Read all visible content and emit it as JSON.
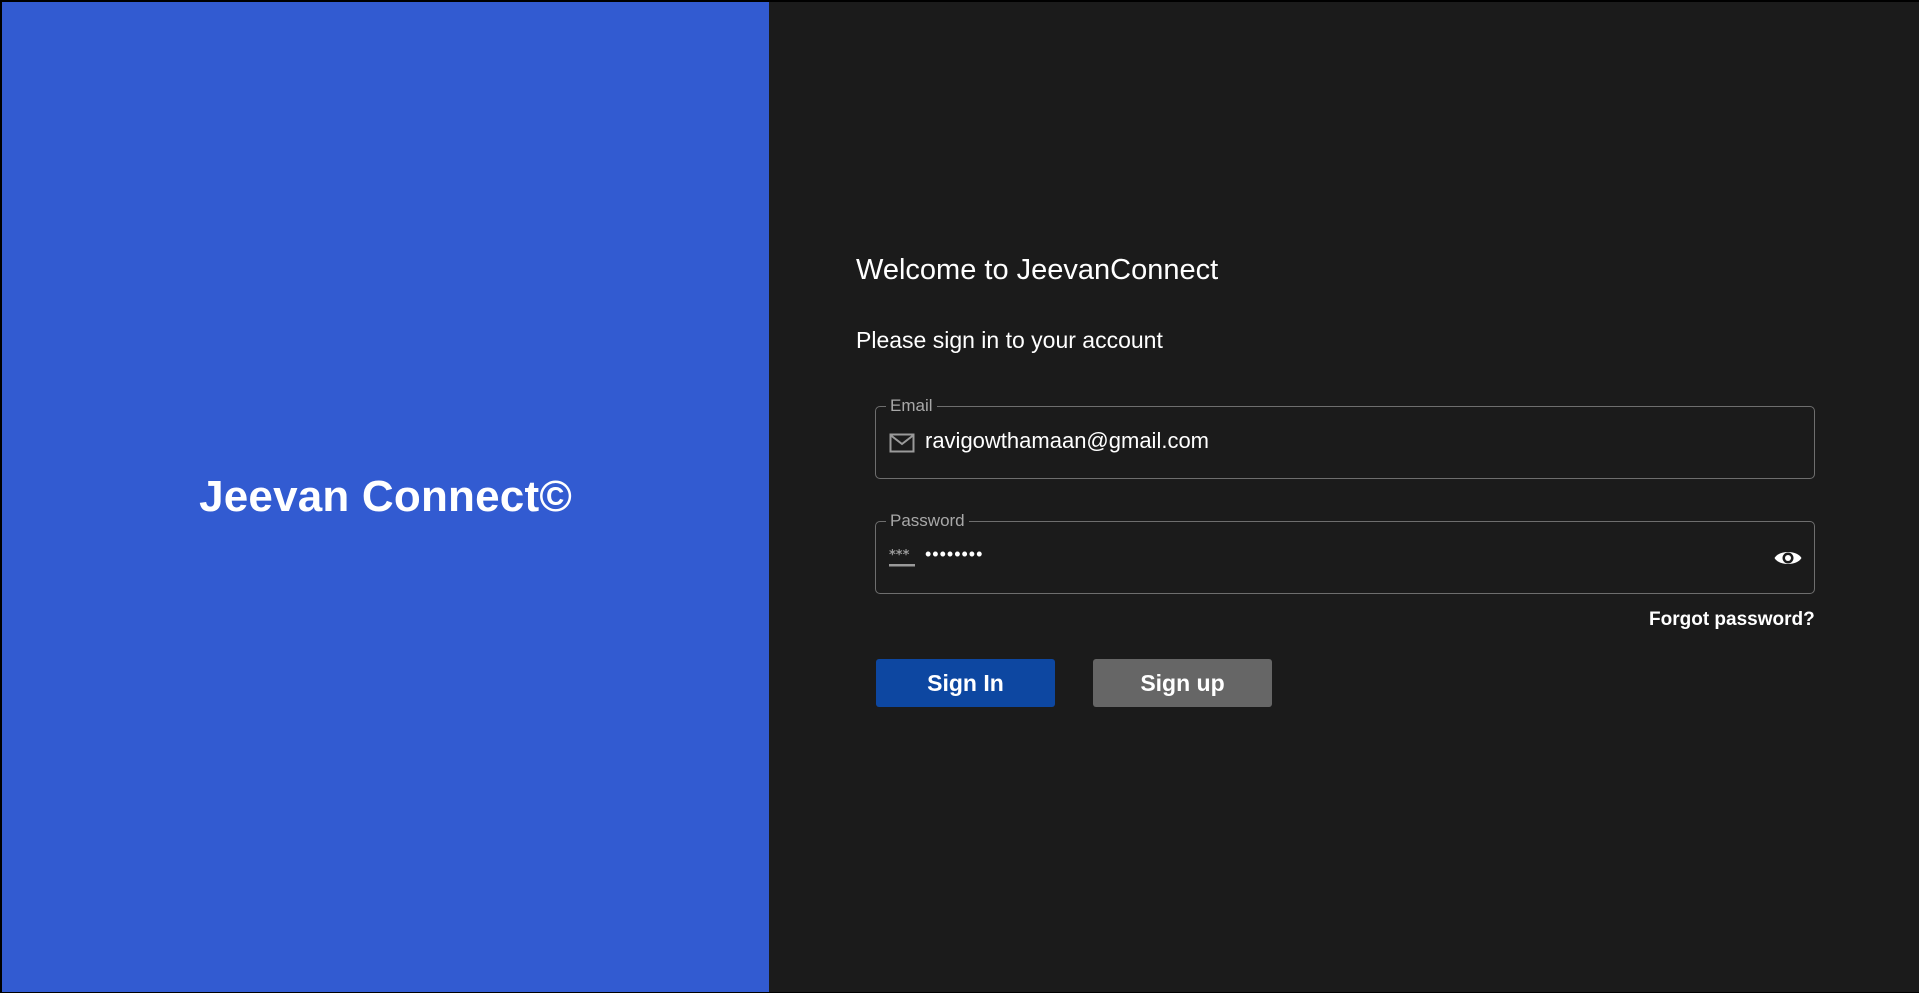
{
  "brand": {
    "title": "Jeevan Connect©",
    "background": "#325bd1"
  },
  "login": {
    "background": "#1b1b1b",
    "welcome": "Welcome to JeevanConnect",
    "subtitle": "Please sign in to your account",
    "email": {
      "label": "Email",
      "value": "ravigowthamaan@gmail.com",
      "icon": "mail-icon"
    },
    "password": {
      "label": "Password",
      "value": "••••••••",
      "icon": "password-icon",
      "toggle_icon": "eye-icon"
    },
    "forgot_label": "Forgot password?",
    "signin_label": "Sign In",
    "signup_label": "Sign up",
    "signin_color": "#0d47a1",
    "signup_color": "#666666"
  }
}
